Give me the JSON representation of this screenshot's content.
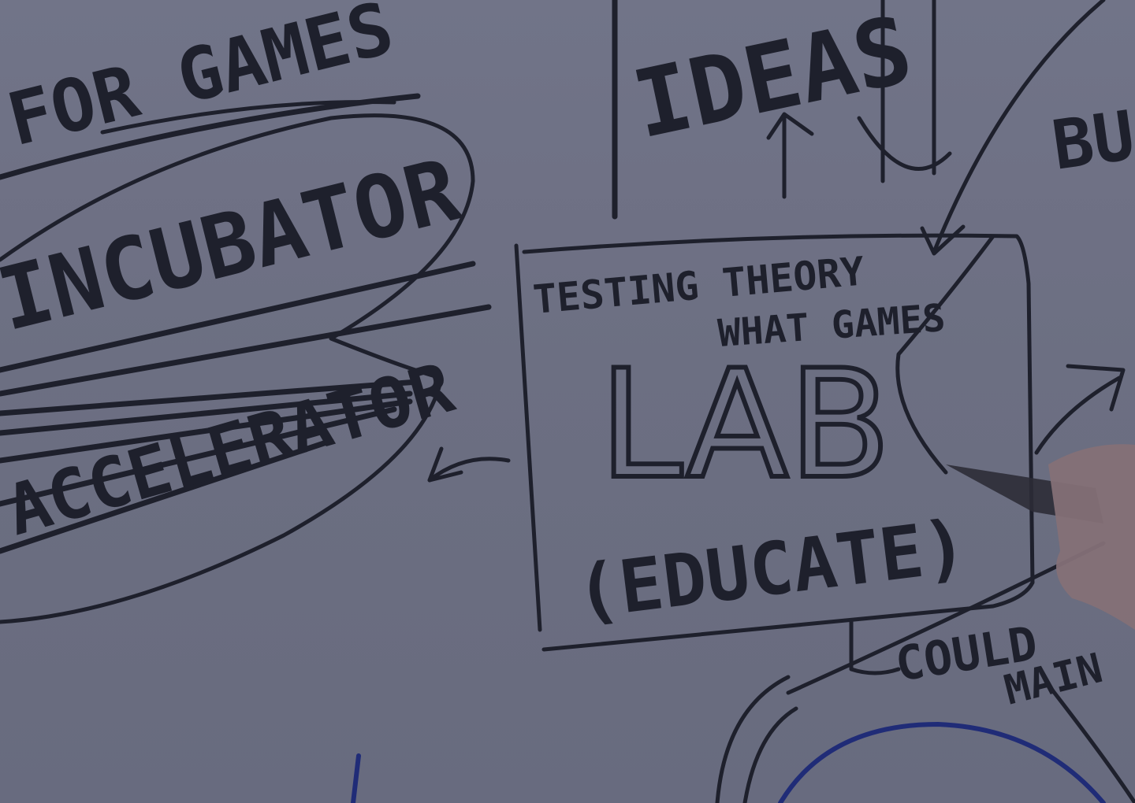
{
  "board": {
    "text_for_games": "FOR GAMES",
    "text_incubator": "INCUBATOR",
    "text_accelerator": "ACCELERATOR",
    "text_ideas": "IDEAS",
    "text_testing": "TESTING THEORY",
    "text_what_games": "WHAT GAMES",
    "text_lab": "LAB",
    "text_educate": "(EDUCATE)",
    "text_bu": "BU",
    "text_could": "COULD",
    "text_main": "MAIN"
  },
  "colors": {
    "board": "#717385",
    "marker_black": "#1c1d26",
    "marker_blue": "#1e2a78",
    "skin": "#c98d76"
  }
}
